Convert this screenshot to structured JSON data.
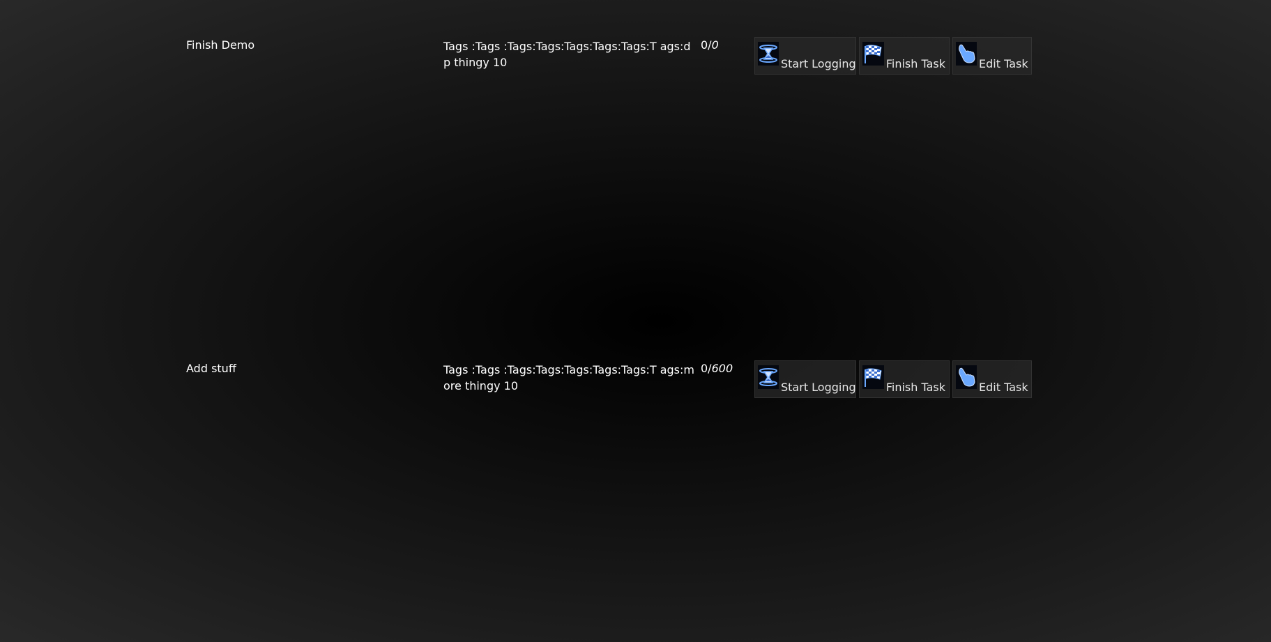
{
  "tasks": [
    {
      "name": "Finish Demo",
      "tags": "Tags :Tags :Tags:Tags:Tags:Tags:Tags:T ags:dp thingy 10",
      "progress_done": "0/",
      "progress_goal": "0",
      "start_label": "Start Logging",
      "finish_label": "Finish Task",
      "edit_label": "Edit Task"
    },
    {
      "name": "Add stuff",
      "tags": "Tags :Tags :Tags:Tags:Tags:Tags:Tags:T ags:more thingy 10",
      "progress_done": "0/",
      "progress_goal": "600",
      "start_label": "Start Logging",
      "finish_label": "Finish Task",
      "edit_label": "Edit Task"
    }
  ],
  "icons": {
    "start": "hourglass-icon",
    "finish": "checkered-flag-icon",
    "edit": "pointing-hand-icon"
  },
  "colors": {
    "icon_accent": "#6aa8ff",
    "text": "#ffffff"
  }
}
